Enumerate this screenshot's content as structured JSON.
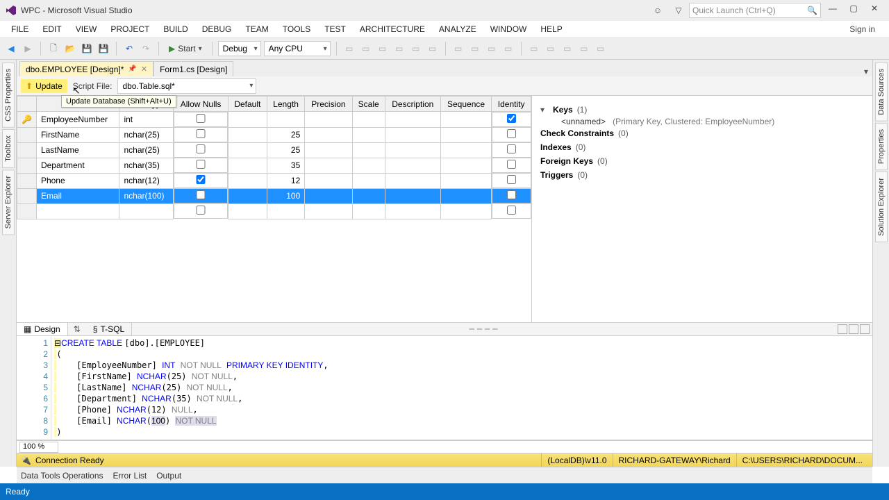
{
  "window": {
    "title": "WPC - Microsoft Visual Studio"
  },
  "quickLaunch": {
    "placeholder": "Quick Launch (Ctrl+Q)"
  },
  "menu": {
    "items": [
      "FILE",
      "EDIT",
      "VIEW",
      "PROJECT",
      "BUILD",
      "DEBUG",
      "TEAM",
      "TOOLS",
      "TEST",
      "ARCHITECTURE",
      "ANALYZE",
      "WINDOW",
      "HELP"
    ],
    "signin": "Sign in"
  },
  "toolbar": {
    "start": "Start",
    "config": "Debug",
    "platform": "Any CPU"
  },
  "sideLeft": [
    "CSS Properties",
    "Toolbox",
    "Server Explorer"
  ],
  "sideRight": [
    "Data Sources",
    "Properties",
    "Solution Explorer"
  ],
  "docTabs": {
    "active": "dbo.EMPLOYEE [Design]*",
    "other": "Form1.cs [Design]"
  },
  "designBar": {
    "update": "Update",
    "tooltip": "Update Database (Shift+Alt+U)",
    "scriptLabel": "Script File:",
    "scriptFile": "dbo.Table.sql*"
  },
  "grid": {
    "headers": [
      "",
      "Name",
      "Data Type",
      "Allow Nulls",
      "Default",
      "Length",
      "Precision",
      "Scale",
      "Description",
      "Sequence",
      "Identity"
    ],
    "rows": [
      {
        "pk": true,
        "name": "EmployeeNumber",
        "type": "int",
        "nulls": false,
        "len": "",
        "identity": true,
        "sel": false
      },
      {
        "pk": false,
        "name": "FirstName",
        "type": "nchar(25)",
        "nulls": false,
        "len": "25",
        "identity": false,
        "sel": false
      },
      {
        "pk": false,
        "name": "LastName",
        "type": "nchar(25)",
        "nulls": false,
        "len": "25",
        "identity": false,
        "sel": false
      },
      {
        "pk": false,
        "name": "Department",
        "type": "nchar(35)",
        "nulls": false,
        "len": "35",
        "identity": false,
        "sel": false
      },
      {
        "pk": false,
        "name": "Phone",
        "type": "nchar(12)",
        "nulls": true,
        "len": "12",
        "identity": false,
        "sel": false
      },
      {
        "pk": false,
        "name": "Email",
        "type": "nchar(100)",
        "nulls": false,
        "len": "100",
        "identity": false,
        "sel": true
      }
    ]
  },
  "props": {
    "keys": {
      "label": "Keys",
      "count": "(1)",
      "detail_name": "<unnamed>",
      "detail_desc": "(Primary Key, Clustered: EmployeeNumber)"
    },
    "check": {
      "label": "Check Constraints",
      "count": "(0)"
    },
    "indexes": {
      "label": "Indexes",
      "count": "(0)"
    },
    "fkeys": {
      "label": "Foreign Keys",
      "count": "(0)"
    },
    "triggers": {
      "label": "Triggers",
      "count": "(0)"
    }
  },
  "split": {
    "design": "Design",
    "tsql": "T-SQL"
  },
  "sql": {
    "lines": [
      1,
      2,
      3,
      4,
      5,
      6,
      7,
      8,
      9
    ]
  },
  "zoom": "100 %",
  "statusDesign": {
    "conn": "Connection Ready",
    "server": "(LocalDB)\\v11.0",
    "user": "RICHARD-GATEWAY\\Richard",
    "path": "C:\\USERS\\RICHARD\\DOCUM..."
  },
  "outputTabs": [
    "Data Tools Operations",
    "Error List",
    "Output"
  ],
  "status": "Ready"
}
